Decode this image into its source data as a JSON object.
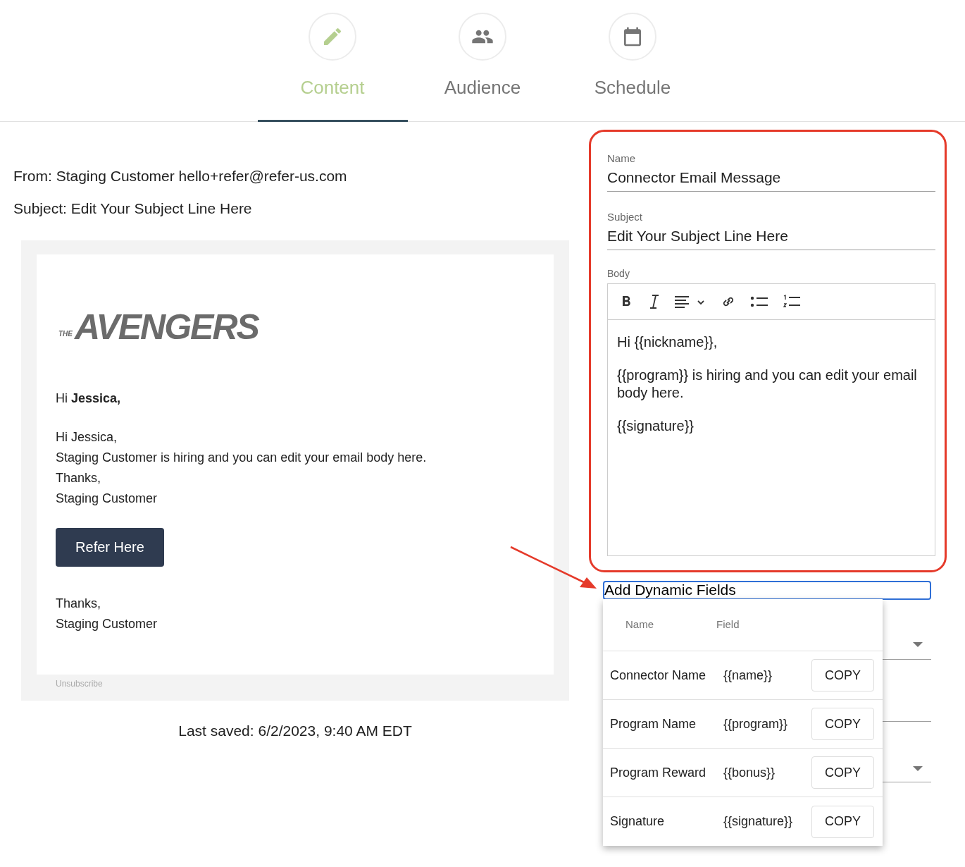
{
  "tabs": [
    {
      "label": "Content",
      "selected": true
    },
    {
      "label": "Audience",
      "selected": false
    },
    {
      "label": "Schedule",
      "selected": false
    }
  ],
  "preview": {
    "from": "From: Staging Customer hello+refer@refer-us.com",
    "subject": "Subject: Edit Your Subject Line Here",
    "logo": {
      "prefix": "THE",
      "text": "AVENGERS"
    },
    "greeting": "Hi **Jessica,**",
    "body_lines": [
      "Hi Jessica,",
      "Staging Customer is hiring and you can edit your email body here.",
      "Thanks,",
      "Staging Customer"
    ],
    "button": "Refer Here",
    "closing_lines": [
      "Thanks,",
      "Staging Customer"
    ],
    "unsubscribe": "Unsubscribe",
    "last_saved": "Last saved: 6/2/2023, 9:40 AM EDT"
  },
  "form": {
    "name": {
      "label": "Name",
      "value": "Connector Email Message"
    },
    "subject": {
      "label": "Subject",
      "value": "Edit Your Subject Line Here"
    },
    "body": {
      "label": "Body",
      "paragraphs": [
        "Hi {{nickname}},",
        "{{program}} is hiring and you can edit your email body here.",
        "{{signature}}"
      ]
    },
    "dynamic_fields": {
      "label": "Add Dynamic Fields",
      "columns": [
        "Name",
        "Field"
      ],
      "rows": [
        {
          "name": "Connector Name",
          "field": "{{name}}",
          "action": "COPY"
        },
        {
          "name": "Program Name",
          "field": "{{program}}",
          "action": "COPY"
        },
        {
          "name": "Program Reward",
          "field": "{{bonus}}",
          "action": "COPY"
        },
        {
          "name": "Signature",
          "field": "{{signature}}",
          "action": "COPY"
        }
      ]
    }
  }
}
